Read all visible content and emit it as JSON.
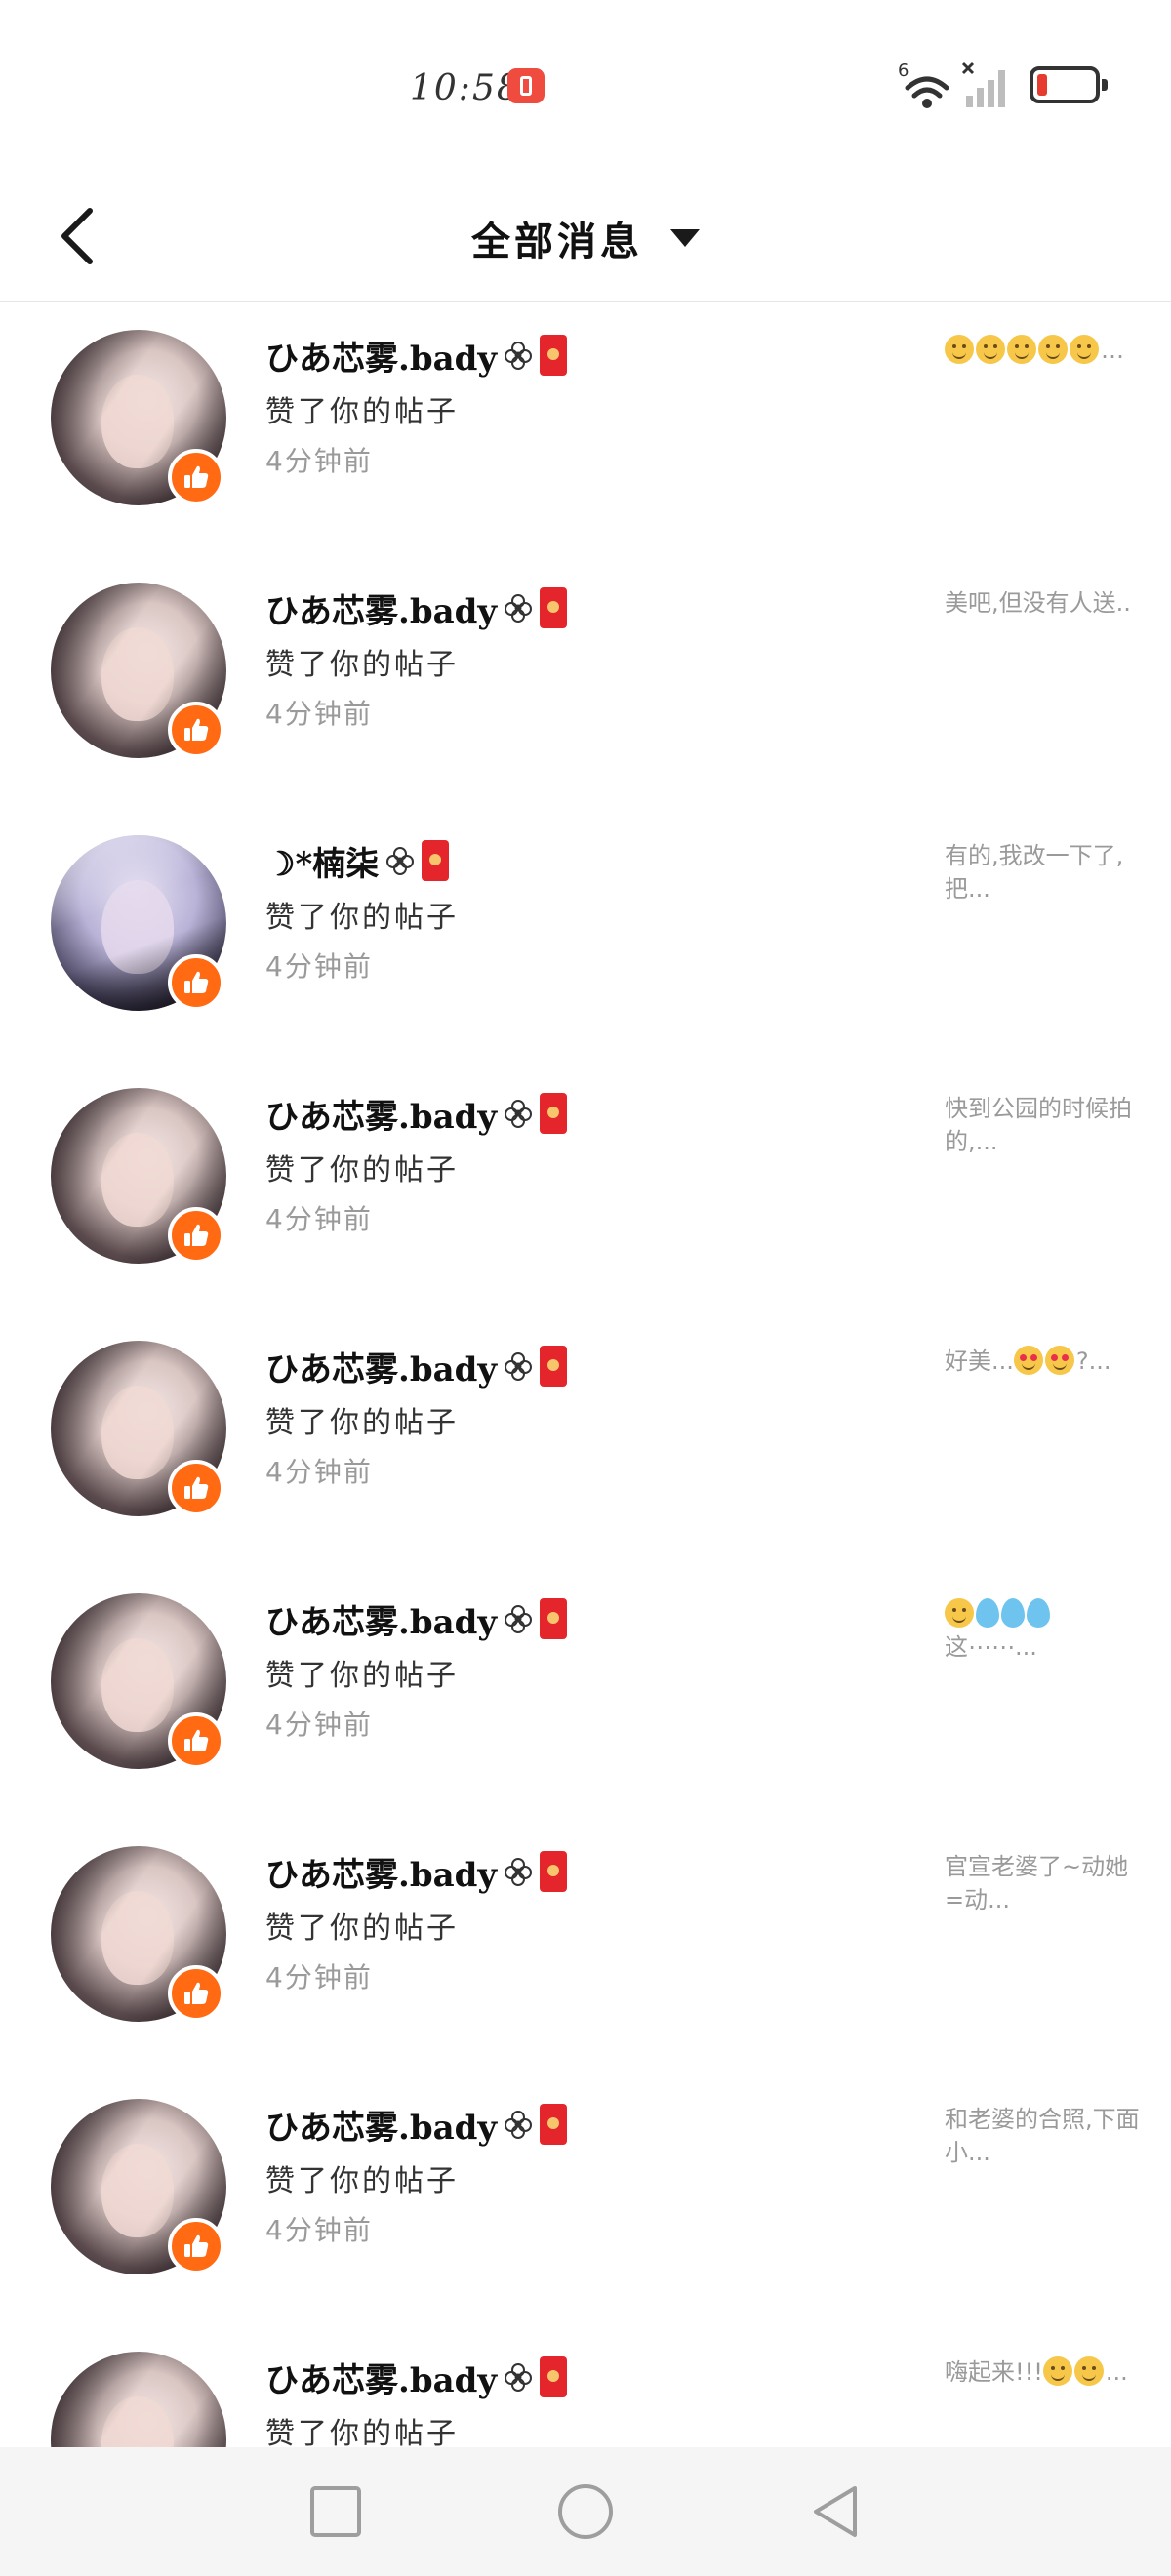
{
  "status_bar": {
    "time": "10:58",
    "network_label": "6"
  },
  "header": {
    "title": "全部消息"
  },
  "messages": [
    {
      "name": "ひあ芯雾.bady",
      "action": "赞了你的帖子",
      "time": "4分钟前",
      "preview_text": "…",
      "preview_emojis": [
        "smile",
        "smile",
        "smile",
        "smile",
        "smile"
      ],
      "avatar": "girl-photo"
    },
    {
      "name": "ひあ芯雾.bady",
      "action": "赞了你的帖子",
      "time": "4分钟前",
      "preview_text": "美吧,但没有人送..",
      "preview_emojis": [],
      "avatar": "girl-photo"
    },
    {
      "name": "☽*楠柒",
      "action": "赞了你的帖子",
      "time": "4分钟前",
      "preview_text": "有的,我改一下了,把...",
      "preview_emojis": [],
      "avatar": "anime-girl"
    },
    {
      "name": "ひあ芯雾.bady",
      "action": "赞了你的帖子",
      "time": "4分钟前",
      "preview_text": "快到公园的时候拍的,...",
      "preview_emojis": [],
      "avatar": "girl-photo"
    },
    {
      "name": "ひあ芯雾.bady",
      "action": "赞了你的帖子",
      "time": "4分钟前",
      "preview_text_before": "好美...",
      "preview_emojis": [
        "heart-eyes",
        "heart-eyes"
      ],
      "preview_text": "?...",
      "avatar": "girl-photo"
    },
    {
      "name": "ひあ芯雾.bady",
      "action": "赞了你的帖子",
      "time": "4分钟前",
      "preview_text": "这⋯⋯...",
      "preview_emojis": [
        "smile",
        "sweat",
        "sweat",
        "sweat"
      ],
      "avatar": "girl-photo"
    },
    {
      "name": "ひあ芯雾.bady",
      "action": "赞了你的帖子",
      "time": "4分钟前",
      "preview_text": "官宣老婆了~动她=动...",
      "preview_emojis": [],
      "avatar": "girl-photo"
    },
    {
      "name": "ひあ芯雾.bady",
      "action": "赞了你的帖子",
      "time": "4分钟前",
      "preview_text": "和老婆的合照,下面小...",
      "preview_emojis": [],
      "avatar": "girl-photo"
    },
    {
      "name": "ひあ芯雾.bady",
      "action": "赞了你的帖子",
      "time": "",
      "preview_text_before": "嗨起来!!!",
      "preview_emojis": [
        "wink",
        "wink"
      ],
      "preview_text": "...",
      "avatar": "girl-photo"
    }
  ],
  "icons": {
    "back": "chevron-left-icon",
    "dropdown": "caret-down-icon",
    "like": "thumbs-up-icon",
    "name_flower": "flower-icon",
    "name_packet": "red-packet-icon",
    "nav_recent": "square-icon",
    "nav_home": "circle-icon",
    "nav_back": "triangle-back-icon"
  },
  "colors": {
    "like_badge": "#ff6a13",
    "red_packet": "#e4262c",
    "preview_text": "#9a9a9a",
    "battery_low": "#e63c2f"
  }
}
